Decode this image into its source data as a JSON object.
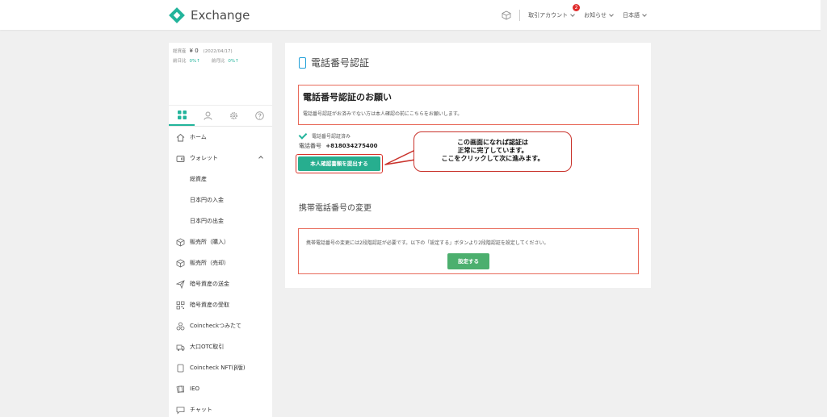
{
  "header": {
    "brand": "Exchange",
    "nav": [
      {
        "label": "取引アカウント",
        "badge": "2"
      },
      {
        "label": "お知らせ"
      },
      {
        "label": "日本語"
      }
    ]
  },
  "sidebar": {
    "assets": {
      "total_label": "総資産",
      "total_value": "¥ 0",
      "date": "(2022/04/17)",
      "day_label": "前日比",
      "day_value": "0%↑",
      "month_label": "前月比",
      "month_value": "0%↑"
    },
    "menu": [
      {
        "label": "ホーム",
        "icon": "home-icon"
      },
      {
        "label": "ウォレット",
        "icon": "wallet-icon"
      },
      {
        "label": "総資産",
        "icon": ""
      },
      {
        "label": "日本円の入金",
        "icon": ""
      },
      {
        "label": "日本円の出金",
        "icon": ""
      },
      {
        "label": "販売所（購入）",
        "icon": "cube-icon"
      },
      {
        "label": "販売所（売却）",
        "icon": "cube-icon"
      },
      {
        "label": "暗号資産の送金",
        "icon": "send-icon"
      },
      {
        "label": "暗号資産の受取",
        "icon": "qr-icon"
      },
      {
        "label": "Coincheckつみたて",
        "icon": "coins-icon"
      },
      {
        "label": "大口OTC取引",
        "icon": "truck-icon"
      },
      {
        "label": "Coincheck NFT(β版)",
        "icon": "nft-icon"
      },
      {
        "label": "IEO",
        "icon": "ieo-icon"
      },
      {
        "label": "チャット",
        "icon": "chat-icon"
      }
    ]
  },
  "main": {
    "title": "電話番号認証",
    "notice_title": "電話番号認証のお願い",
    "notice_text": "電話番号認証がお済みでない方は本人確認の前にこちらをお願いします。",
    "verified_text": "電話番号認証済み",
    "phone_label": "電話番号",
    "phone_value": "+818034275400",
    "submit_button": "本人確認書類を提出する",
    "callout_lines": [
      "この画面になれば認証は",
      "正常に完了しています。",
      "ここをクリックして次に進みます。"
    ],
    "change_title": "携帯電話番号の変更",
    "change_text": "携帯電話番号の変更には2段階認証が必要です。以下の「設定する」ボタンより2段階認証を設定してください。",
    "set_button": "設定する"
  },
  "colors": {
    "accent": "#22b49b",
    "alert_border": "#e86a5a",
    "button_green": "#4caf6e"
  }
}
